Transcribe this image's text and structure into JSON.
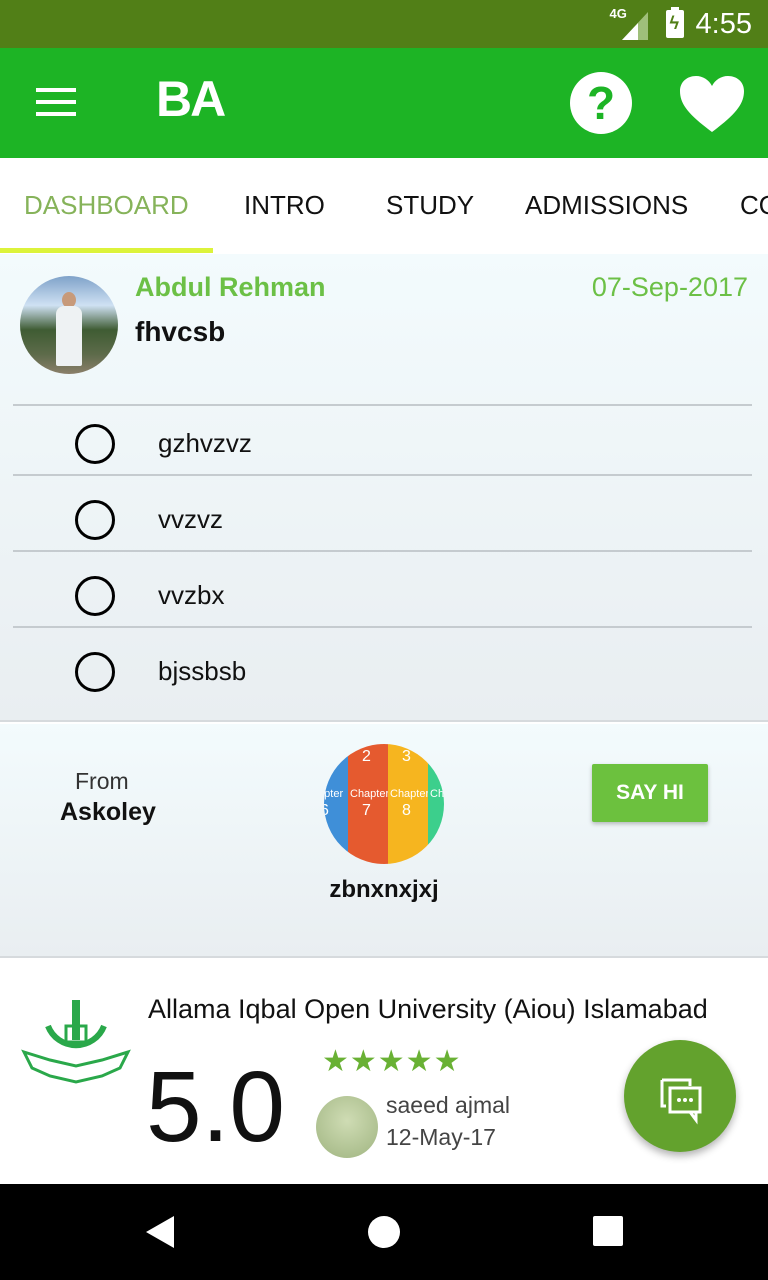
{
  "status_bar": {
    "network": "4G",
    "time": "4:55"
  },
  "app_bar": {
    "title": "BA",
    "help_icon": "question-circle-icon",
    "favorite_icon": "heart-icon",
    "menu_icon": "hamburger-menu-icon"
  },
  "tabs": [
    {
      "label": "DASHBOARD",
      "active": true
    },
    {
      "label": "INTRO",
      "active": false
    },
    {
      "label": "STUDY",
      "active": false
    },
    {
      "label": "ADMISSIONS",
      "active": false
    },
    {
      "label": "CO",
      "active": false
    }
  ],
  "post": {
    "author": "Abdul Rehman",
    "date": "07-Sep-2017",
    "title": "fhvcsb",
    "options": [
      "gzhvzvz",
      "vvzvz",
      "vvzbx",
      "bjssbsb"
    ]
  },
  "hi_card": {
    "from_label": "From",
    "from_name": "Askoley",
    "username": "zbnxnxjxj",
    "say_hi_label": "SAY HI",
    "picture": {
      "chapters": [
        "Chapter",
        "Chapter",
        "Chapter",
        "Chapter"
      ],
      "numbers": [
        "6",
        "2",
        "7",
        "3",
        "8"
      ]
    }
  },
  "review": {
    "university": "Allama Iqbal Open University (Aiou) Islamabad",
    "rating": "5.0",
    "stars": 5,
    "stars_text": "★★★★★",
    "reviewer": "saeed ajmal",
    "date": "12-May-17"
  },
  "colors": {
    "primary": "#1db425",
    "status_bar": "#517f17",
    "accent_green": "#6cc046",
    "tab_indicator": "#dcf33b",
    "fab": "#63a22d"
  }
}
